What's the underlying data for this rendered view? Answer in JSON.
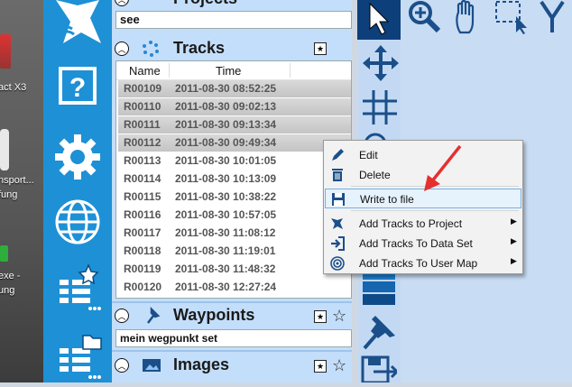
{
  "desktop": {
    "labels": [
      "act X3",
      "nsport...",
      "fung",
      "exe -",
      "ung"
    ]
  },
  "appbar": {
    "items": [
      "app-logo-icon",
      "help-icon",
      "settings-icon",
      "globe-icon",
      "favorite-list-icon",
      "folder-list-icon"
    ]
  },
  "panels": {
    "projects": {
      "title": "Projects",
      "field_value": "see"
    },
    "tracks": {
      "title": "Tracks",
      "columns": [
        "Name",
        "Time"
      ],
      "rows": [
        {
          "name": "R00109",
          "time": "2011-08-30 08:52:25",
          "selected": true
        },
        {
          "name": "R00110",
          "time": "2011-08-30 09:02:13",
          "selected": true
        },
        {
          "name": "R00111",
          "time": "2011-08-30 09:13:34",
          "selected": true
        },
        {
          "name": "R00112",
          "time": "2011-08-30 09:49:34",
          "selected": true
        },
        {
          "name": "R00113",
          "time": "2011-08-30 10:01:05",
          "selected": false
        },
        {
          "name": "R00114",
          "time": "2011-08-30 10:13:09",
          "selected": false
        },
        {
          "name": "R00115",
          "time": "2011-08-30 10:38:22",
          "selected": false
        },
        {
          "name": "R00116",
          "time": "2011-08-30 10:57:05",
          "selected": false
        },
        {
          "name": "R00117",
          "time": "2011-08-30 11:08:12",
          "selected": false
        },
        {
          "name": "R00118",
          "time": "2011-08-30 11:19:01",
          "selected": false
        },
        {
          "name": "R00119",
          "time": "2011-08-30 11:48:32",
          "selected": false
        },
        {
          "name": "R00120",
          "time": "2011-08-30 12:27:24",
          "selected": false
        }
      ]
    },
    "waypoints": {
      "title": "Waypoints",
      "field_value": "mein wegpunkt set"
    },
    "images": {
      "title": "Images"
    }
  },
  "context_menu": {
    "items": [
      {
        "label": "Edit",
        "icon": "pencil-icon",
        "submenu": false
      },
      {
        "label": "Delete",
        "icon": "trash-icon",
        "submenu": false
      },
      {
        "label": "Write to file",
        "icon": "floppy-disk-icon",
        "submenu": false,
        "highlighted": true
      },
      {
        "label": "Add Tracks to Project",
        "icon": "project-icon",
        "submenu": true
      },
      {
        "label": "Add Tracks To Data Set",
        "icon": "import-arrow-icon",
        "submenu": true
      },
      {
        "label": "Add Tracks To User Map",
        "icon": "target-icon",
        "submenu": true
      }
    ]
  },
  "tools": [
    "select-arrow-icon",
    "zoom-icon",
    "pan-hand-icon",
    "rect-select-icon",
    "move-icon",
    "grid-icon",
    "pin-icon",
    "save-icon"
  ],
  "colors": {
    "appbar": "#1e90d6",
    "panel": "#c3defa",
    "accent_red": "#e53030",
    "menu_highlight": "#e6f2fc"
  }
}
